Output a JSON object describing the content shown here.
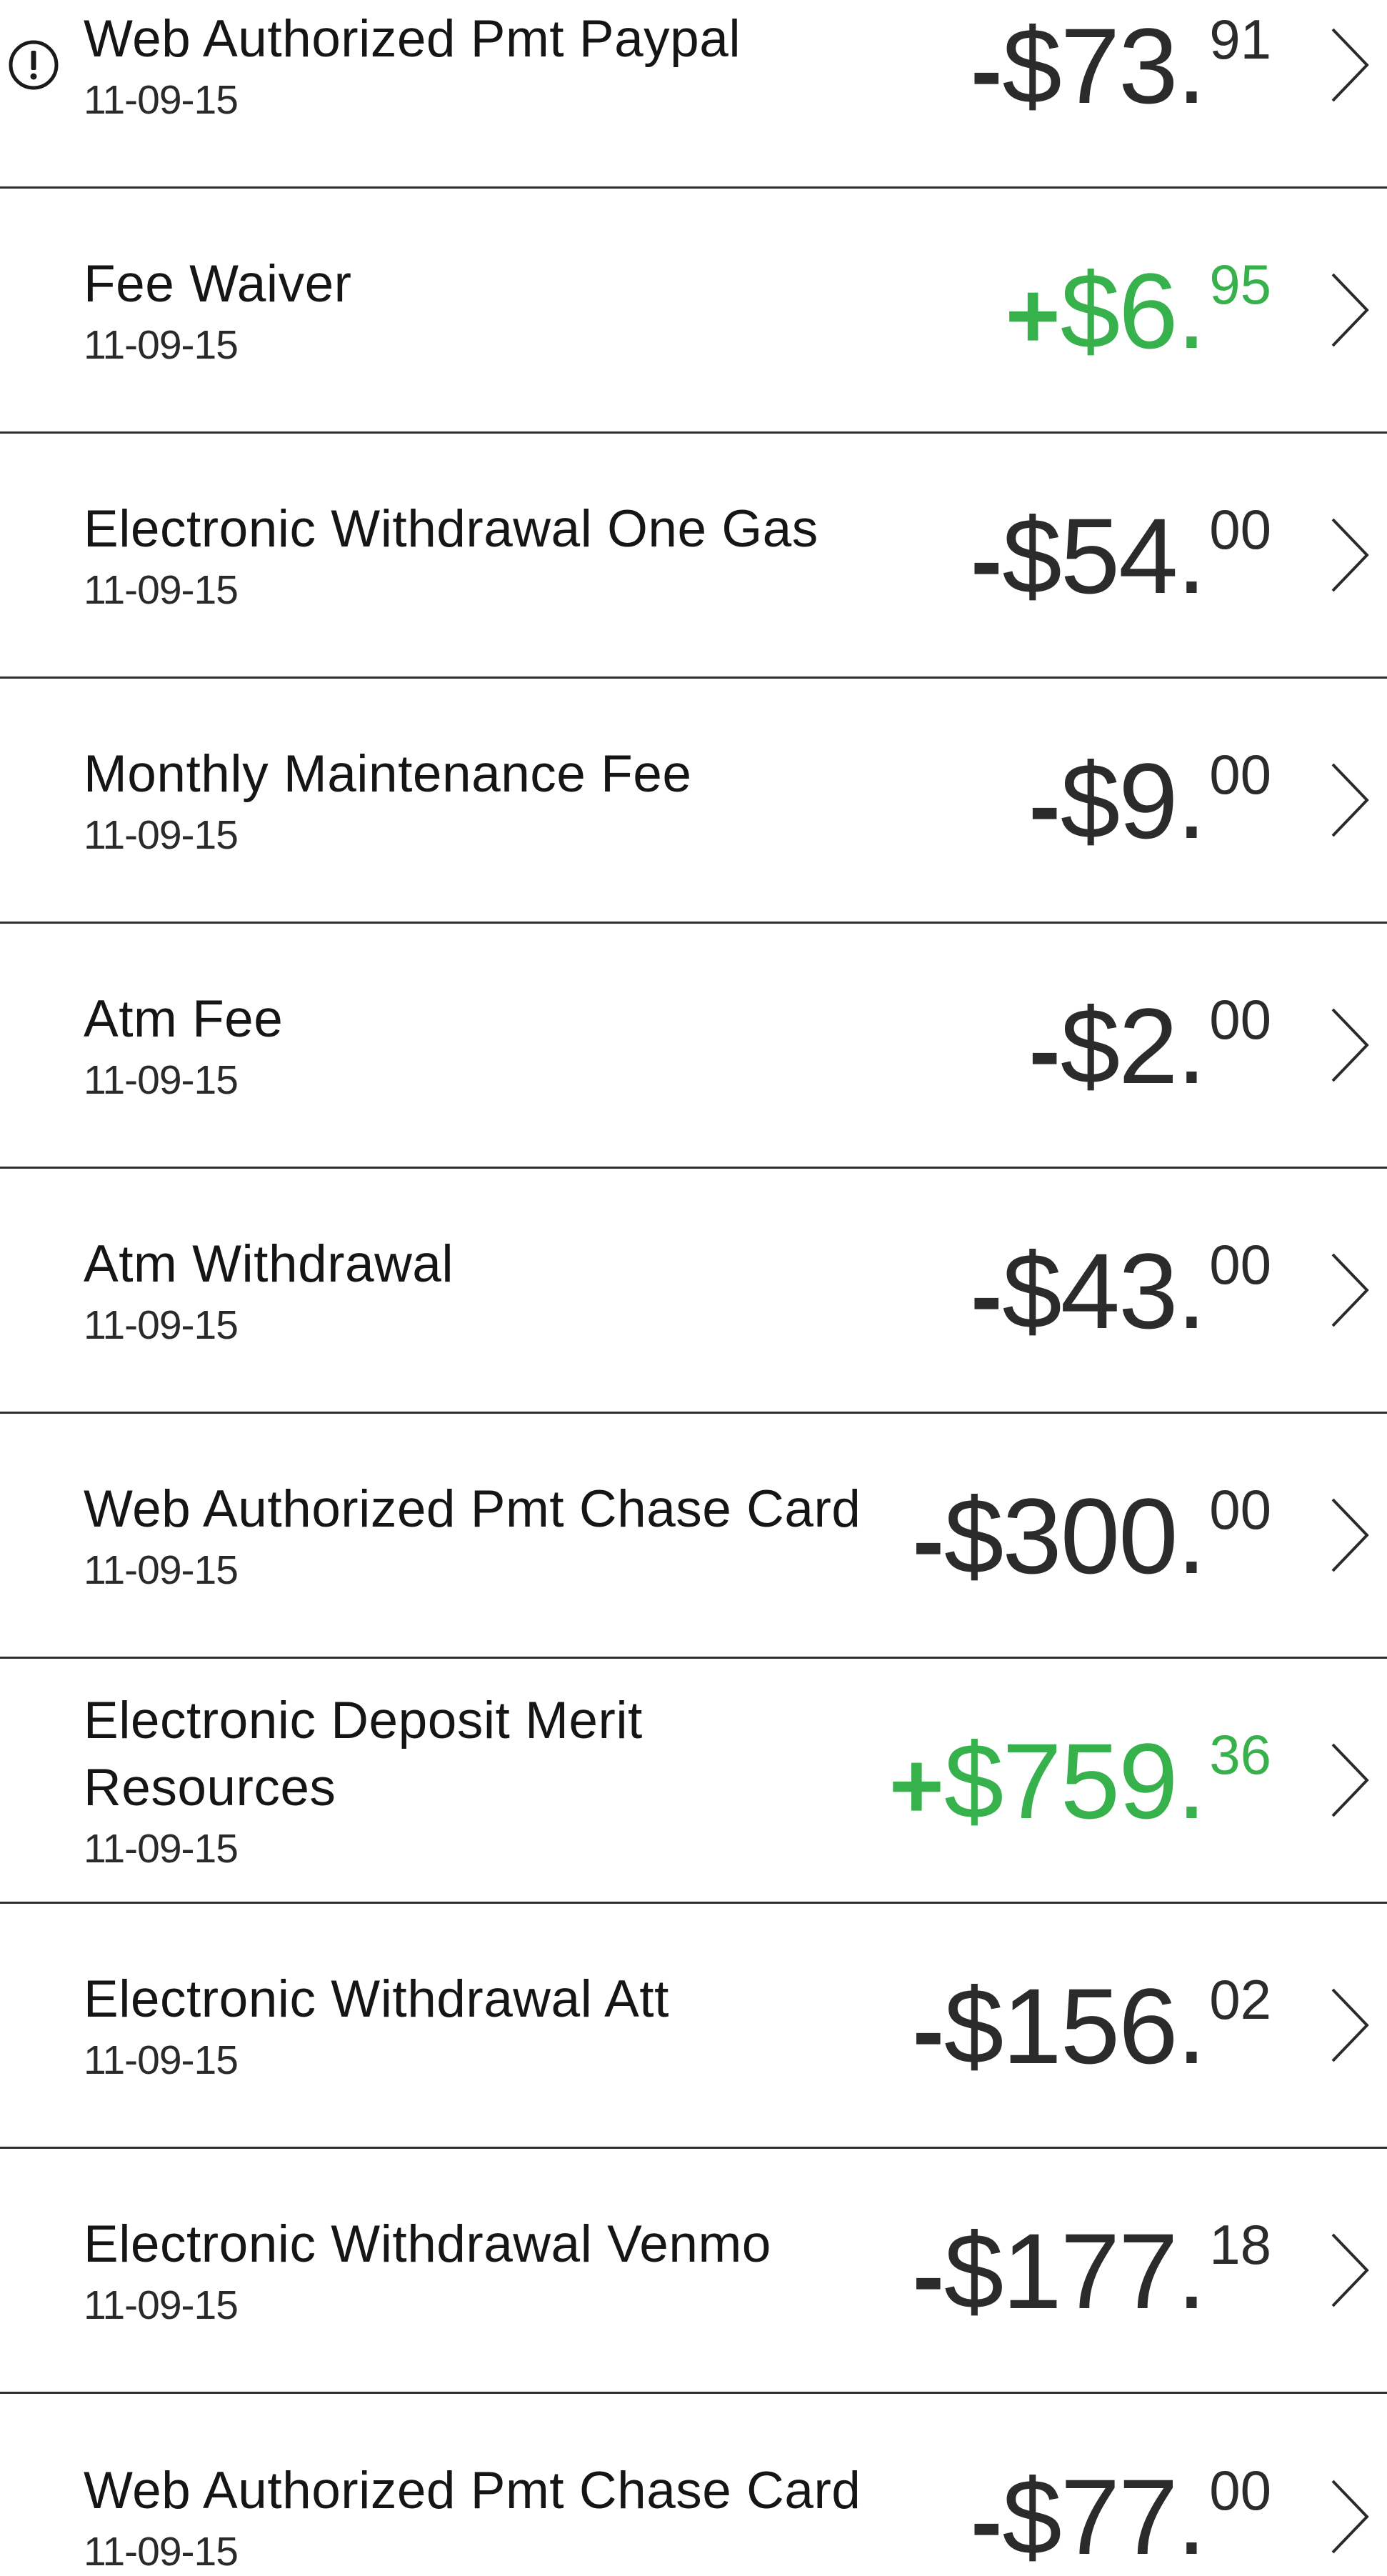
{
  "transactions": [
    {
      "title": "Web Authorized Pmt Paypal",
      "date": "11-09-15",
      "sign": "-",
      "dollars": "$73.",
      "cents": "91",
      "type": "debit",
      "alert": true
    },
    {
      "title": "Fee Waiver",
      "date": "11-09-15",
      "sign": "+",
      "dollars": "$6.",
      "cents": "95",
      "type": "credit",
      "alert": false
    },
    {
      "title": "Electronic Withdrawal One Gas",
      "date": "11-09-15",
      "sign": "-",
      "dollars": "$54.",
      "cents": "00",
      "type": "debit",
      "alert": false
    },
    {
      "title": "Monthly Maintenance Fee",
      "date": "11-09-15",
      "sign": "-",
      "dollars": "$9.",
      "cents": "00",
      "type": "debit",
      "alert": false
    },
    {
      "title": "Atm Fee",
      "date": "11-09-15",
      "sign": "-",
      "dollars": "$2.",
      "cents": "00",
      "type": "debit",
      "alert": false
    },
    {
      "title": "Atm Withdrawal",
      "date": "11-09-15",
      "sign": "-",
      "dollars": "$43.",
      "cents": "00",
      "type": "debit",
      "alert": false
    },
    {
      "title": "Web Authorized Pmt Chase Card",
      "date": "11-09-15",
      "sign": "-",
      "dollars": "$300.",
      "cents": "00",
      "type": "debit",
      "alert": false
    },
    {
      "title": "Electronic Deposit Merit Resources",
      "date": "11-09-15",
      "sign": "+",
      "dollars": "$759.",
      "cents": "36",
      "type": "credit",
      "alert": false
    },
    {
      "title": "Electronic Withdrawal Att",
      "date": "11-09-15",
      "sign": "-",
      "dollars": "$156.",
      "cents": "02",
      "type": "debit",
      "alert": false
    },
    {
      "title": "Electronic Withdrawal Venmo",
      "date": "11-09-15",
      "sign": "-",
      "dollars": "$177.",
      "cents": "18",
      "type": "debit",
      "alert": false
    },
    {
      "title": "Web Authorized Pmt Chase Card",
      "date": "11-09-15",
      "sign": "-",
      "dollars": "$77.",
      "cents": "00",
      "type": "debit",
      "alert": false
    }
  ],
  "icons": {
    "chevron": "chevron-right-icon",
    "alert": "exclamation-circle-icon"
  },
  "colors": {
    "credit": "#36b14b",
    "debit": "#2b2b2b",
    "divider": "#2e2e2e"
  }
}
